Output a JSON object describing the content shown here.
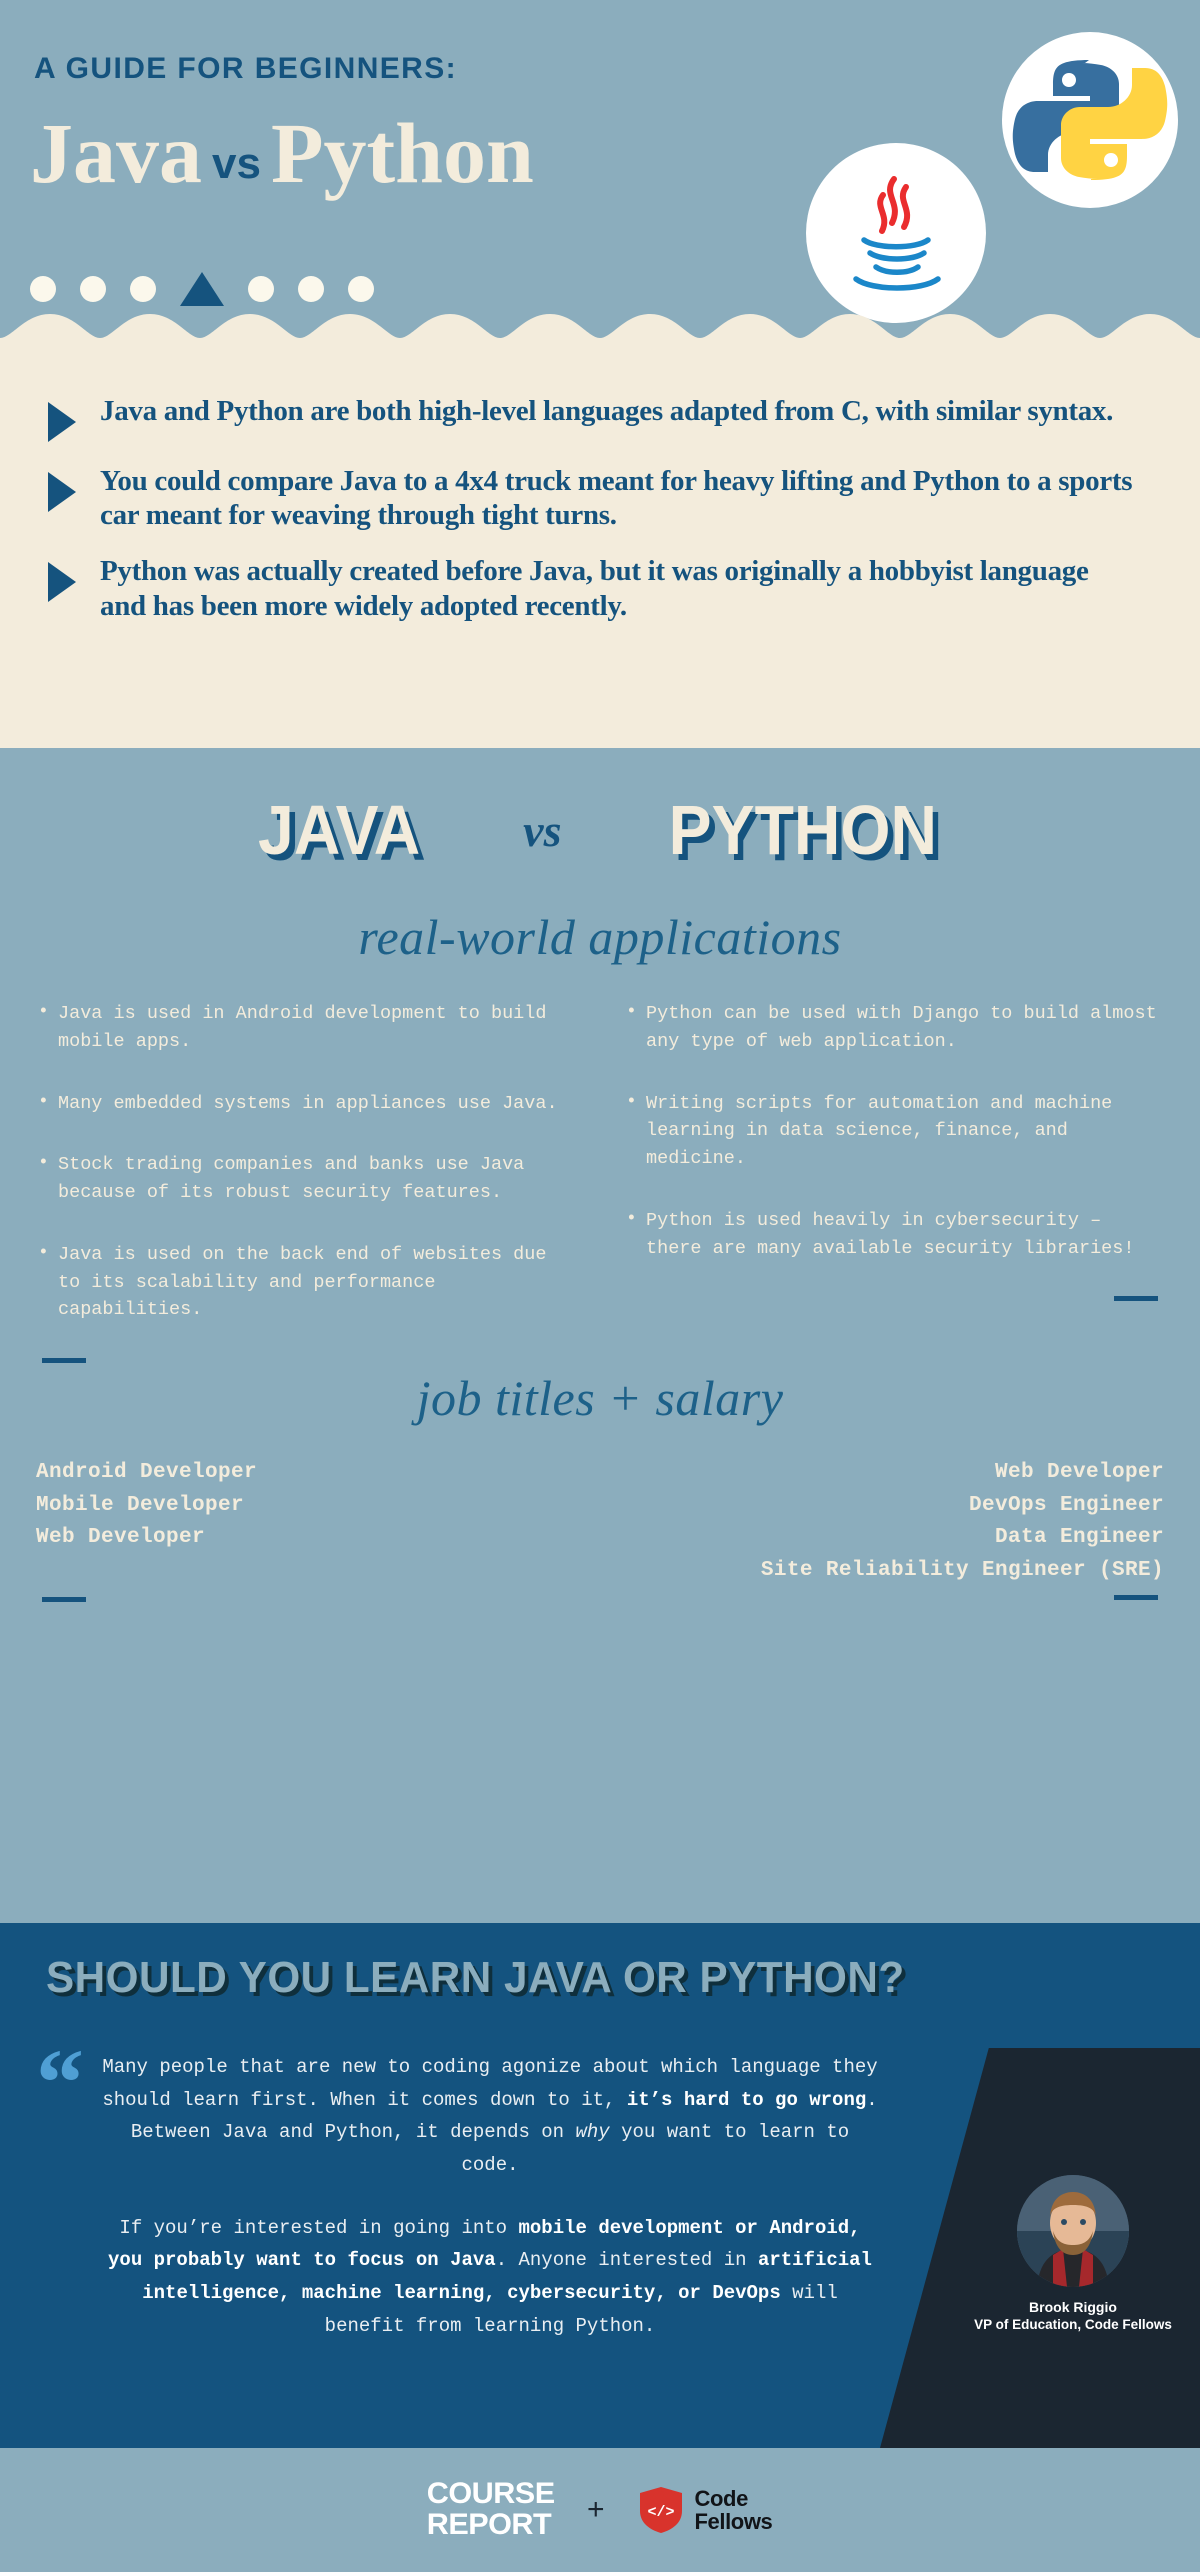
{
  "colors": {
    "blue_bg": "#8badbd",
    "cream": "#f3ecdc",
    "dark_blue": "#15537e",
    "quote_bg": "#14537f",
    "corner_dark": "#1b2631",
    "python_blue": "#376f9f",
    "python_yellow": "#ffd343",
    "java_red": "#ea2d2e",
    "java_blue": "#1b87c9",
    "code_fellows_red": "#d8332c"
  },
  "hero": {
    "kicker": "A GUIDE FOR BEGINNERS:",
    "title_left": "Java",
    "title_vs": "vs",
    "title_right": "Python",
    "java_logo_name": "java-logo",
    "python_logo_name": "python-logo",
    "dot_count": 6,
    "triangle_position": 4
  },
  "facts": [
    "Java and Python are both high-level languages adapted from C, with similar syntax.",
    "You could compare Java to a 4x4 truck meant for heavy lifting and Python to a sports car meant for weaving through tight turns.",
    "Python was actually created before Java, but it was originally a hobbyist language and has been more widely adopted recently."
  ],
  "compare": {
    "left_word": "JAVA",
    "vs": "vs",
    "right_word": "PYTHON",
    "applications_heading": "real-world applications",
    "java_applications": [
      "Java is used in Android development to build mobile apps.",
      "Many embedded systems in appliances use Java.",
      "Stock trading companies and banks use Java because of its robust security features.",
      "Java is used on the back end of websites due to its scalability and performance capabilities."
    ],
    "python_applications": [
      "Python can be used with Django to build almost any type of web application.",
      "Writing scripts for automation and machine learning in data science, finance, and medicine.",
      "Python is used heavily in cybersecurity – there are many available security libraries!"
    ],
    "jobs_heading": "job titles + salary",
    "java_jobs": [
      "Android Developer",
      "Mobile Developer",
      "Web Developer"
    ],
    "python_jobs": [
      "Web Developer",
      "DevOps Engineer",
      "Data Engineer",
      "Site Reliability Engineer (SRE)"
    ]
  },
  "quote": {
    "title": "SHOULD YOU LEARN JAVA OR PYTHON?",
    "paragraph1_part1": "Many people that are new to coding agonize about which language they should learn first. When it comes down to it, ",
    "paragraph1_bold1": "it’s hard to go wrong",
    "paragraph1_part2": ". Between Java and Python, it depends on ",
    "paragraph1_italic": "why",
    "paragraph1_part3": " you want to learn to code.",
    "paragraph2_part1": "If you’re interested in going into ",
    "paragraph2_bold1": "mobile development or Android, you probably want to focus on Java",
    "paragraph2_part2": ". Anyone interested in ",
    "paragraph2_bold2": "artificial intelligence, machine learning, cybersecurity, or DevOps",
    "paragraph2_part3": " will benefit from learning Python.",
    "author_name": "Brook Riggio",
    "author_role": "VP of Education, Code Fellows"
  },
  "footer": {
    "course_report_line1": "COURSE",
    "course_report_line2": "REPORT",
    "plus": "+",
    "code_fellows_line1": "Code",
    "code_fellows_line2": "Fellows",
    "code_fellows_glyph": "</>"
  }
}
